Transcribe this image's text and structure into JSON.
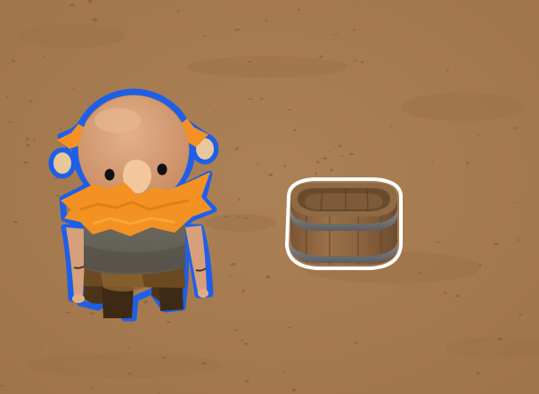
{
  "scene": {
    "ground_color": "#a97d52",
    "ground_shade_color": "#9c7048",
    "ground_speck_color": "#7d5634"
  },
  "character": {
    "kind": "bald old man with orange beard and mustache",
    "state": "selected",
    "outline_color": "#1f5fe8",
    "skin_color": "#d9a279",
    "beard_color": "#f39222",
    "shirt_color": "#6f6a5c",
    "pants_color": "#5a3d1c"
  },
  "barrel": {
    "kind": "wooden half-barrel tub",
    "state": "highlighted",
    "outline_color": "#ffffff",
    "wood_color": "#8c6440",
    "band_color": "#6e6f70"
  }
}
